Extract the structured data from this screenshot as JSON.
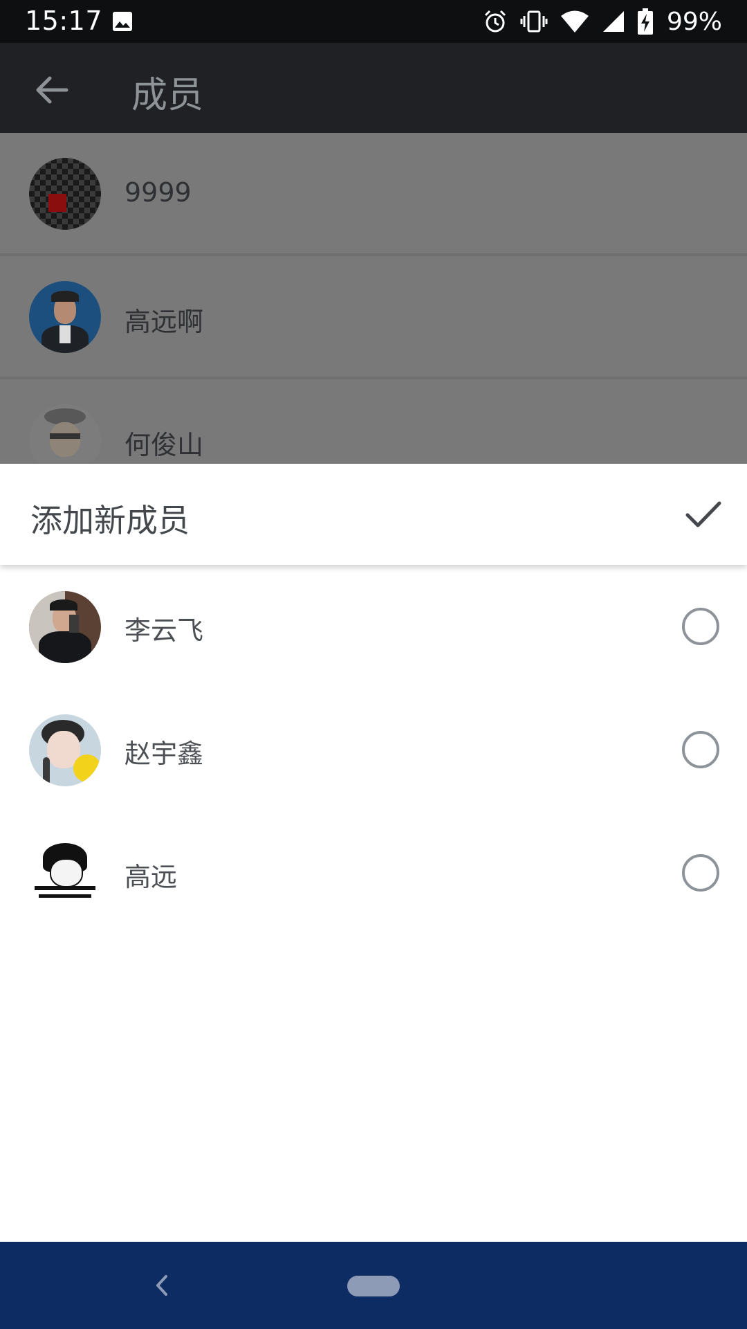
{
  "status_bar": {
    "time": "15:17",
    "battery_percent": "99%",
    "icons": [
      "image-icon",
      "alarm-icon",
      "vibrate-icon",
      "wifi-icon",
      "signal-icon",
      "battery-charging-icon"
    ]
  },
  "app_bar": {
    "title": "成员",
    "back_icon": "back-arrow-icon"
  },
  "members": [
    {
      "name": "9999"
    },
    {
      "name": "高远啊"
    },
    {
      "name": "何俊山"
    }
  ],
  "add_sheet": {
    "title": "添加新成员",
    "confirm_icon": "check-icon",
    "candidates": [
      {
        "name": "李云飞",
        "selected": false
      },
      {
        "name": "赵宇鑫",
        "selected": false
      },
      {
        "name": "高远",
        "selected": false
      }
    ]
  },
  "nav_bar": {
    "icons": [
      "nav-back-icon",
      "nav-home-pill"
    ]
  },
  "colors": {
    "status_bar": "#0e0f11",
    "app_bar": "#1f2125",
    "scrim": "#797979",
    "nav_bar": "#0c2c63"
  }
}
